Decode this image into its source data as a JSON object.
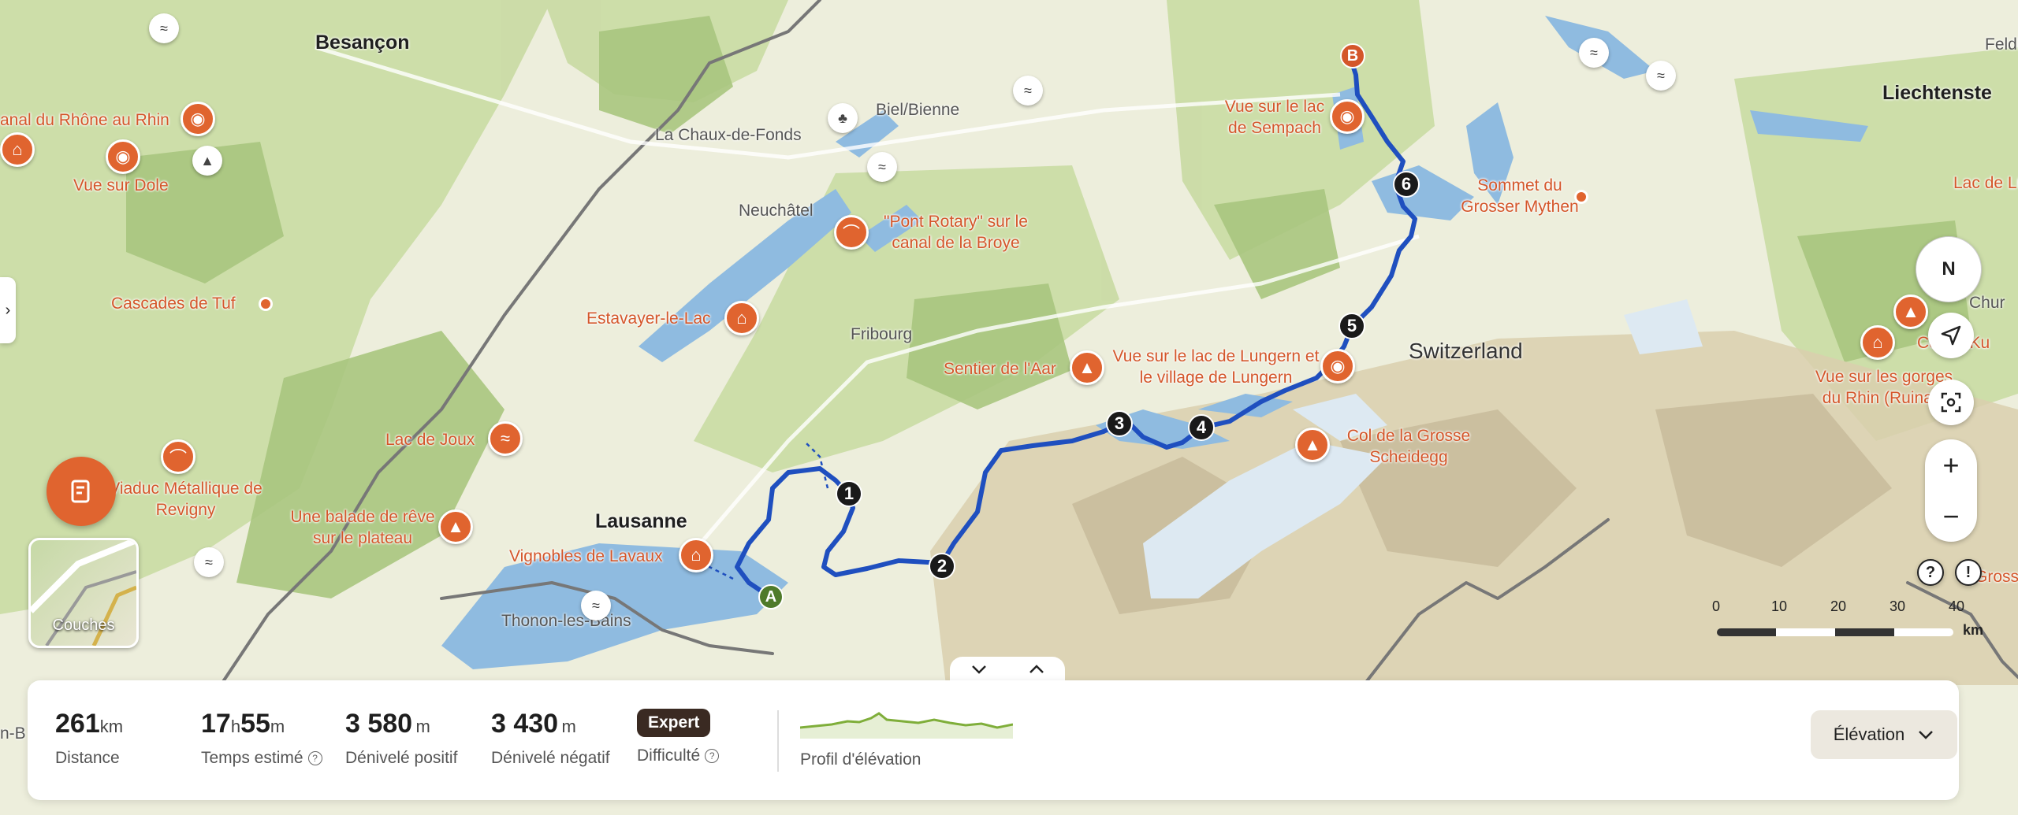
{
  "map": {
    "cities": [
      "Besançon",
      "Lausanne",
      "Liechtenste"
    ],
    "country": "Switzerland",
    "towns": [
      "La Chaux-de-Fonds",
      "Biel/Bienne",
      "Neuchâtel",
      "Fribourg",
      "Thonon-les-Bains",
      "Feldkirc",
      "Chur",
      "n-B"
    ],
    "pois": [
      "anal du Rhône au Rhin",
      "Vue sur Dole",
      "Cascades de Tuf",
      "Lac de Joux",
      "Viaduc Métallique de Revigny",
      "Une balade de rêve sur le plateau",
      "Vignobles de Lavaux",
      "\"Pont Rotary\" sur le canal de la Broye",
      "Estavayer-le-Lac",
      "Sentier de l'Aar",
      "Vue sur le lac de Lungern et le village de Lungern",
      "Col de la Grosse Scheidegg",
      "Vue sur le lac de Sempach",
      "Sommet du Grosser Mythen",
      "Lac de Lüner",
      "Col de Ku",
      "Vue sur les gorges du Rhin (Ruinaul",
      "Gross du"
    ],
    "route_start": "A",
    "route_end": "B",
    "stages": [
      "1",
      "2",
      "3",
      "4",
      "5",
      "6"
    ],
    "route_color": "#1f4fbf",
    "poi_color": "#e0642f"
  },
  "left_panel": {
    "layers_label": "Couches"
  },
  "controls": {
    "compass_label": "N",
    "zoom_in": "+",
    "zoom_out": "−",
    "help_icon": "?",
    "report_icon": "!"
  },
  "scale": {
    "ticks": [
      "0",
      "10",
      "20",
      "30",
      "40"
    ],
    "unit": "km"
  },
  "stats": {
    "distance": {
      "value": "261",
      "unit": "km",
      "label": "Distance"
    },
    "time": {
      "hours": "17",
      "h_unit": "h",
      "minutes": "55",
      "m_unit": "m",
      "label": "Temps estimé"
    },
    "ascent": {
      "value": "3 580",
      "unit": "m",
      "label": "Dénivelé positif"
    },
    "descent": {
      "value": "3 430",
      "unit": "m",
      "label": "Dénivelé négatif"
    },
    "difficulty": {
      "badge": "Expert",
      "label": "Difficulté"
    },
    "profile": {
      "label": "Profil d'élévation"
    }
  },
  "dropdown": {
    "selected": "Élévation"
  },
  "colors": {
    "difficulty_badge": "#3a2a22",
    "elevation_line": "#7fae3a"
  }
}
